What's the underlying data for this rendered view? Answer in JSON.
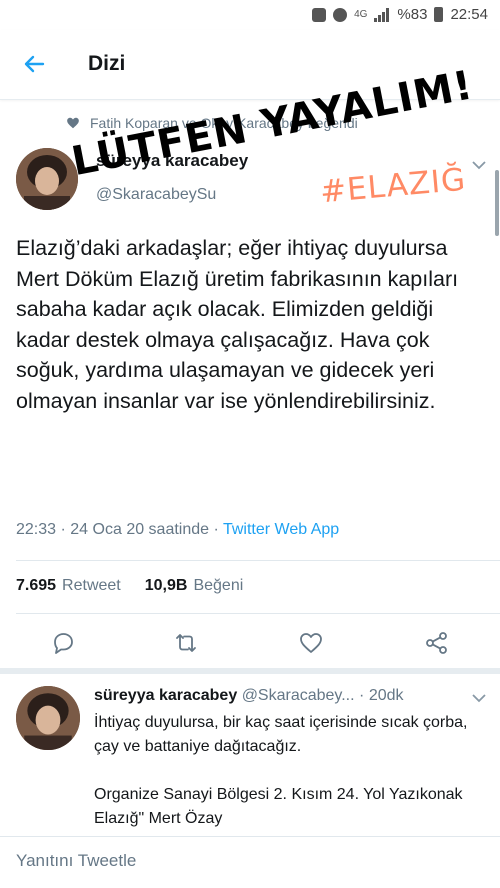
{
  "status_bar": {
    "signal_label": "4G",
    "battery": "%83",
    "time": "22:54"
  },
  "header": {
    "title": "Dizi"
  },
  "social_context": {
    "text": "Fatih Koparan ve Okay Karacabey beğendi"
  },
  "tweet": {
    "author_name": "süreyya karacabey",
    "author_handle": "@SkaracabeySu",
    "text": "Elazığ’daki arkadaşlar; eğer ihtiyaç duyulursa Mert Döküm Elazığ üretim fabrikasının kapıları sabaha kadar açık olacak. Elimizden geldiği kadar destek olmaya çalışacağız. Hava çok soğuk, yardıma ulaşamayan ve gidecek yeri olmayan insanlar var ise yönlendirebilirsiniz.",
    "time": "22:33",
    "date": "24 Oca 20 saatinde",
    "separator": "·",
    "source": "Twitter Web App",
    "retweet_count": "7.695",
    "retweet_label": "Retweet",
    "like_count": "10,9B",
    "like_label": "Beğeni"
  },
  "reply": {
    "author_name": "süreyya karacabey",
    "author_handle": "@Skaracabey...",
    "separator": "·",
    "time": "20dk",
    "text_line1": "İhtiyaç duyulursa, bir kaç saat içerisinde sıcak çorba, çay ve battaniye dağıtacağız.",
    "text_line2": "Organize Sanayi Bölgesi 2. Kısım 24. Yol Yazıkonak Elazığ\" Mert Özay"
  },
  "reply_bar": {
    "placeholder": "Yanıtını Tweetle"
  },
  "overlays": {
    "banner": "LÜTFEN YAYALIM!",
    "hashtag": "#ELAZIĞ"
  },
  "colors": {
    "accent": "#1da1f2",
    "muted": "#657786",
    "text": "#14171a",
    "hashtag": "#ff8a65"
  }
}
